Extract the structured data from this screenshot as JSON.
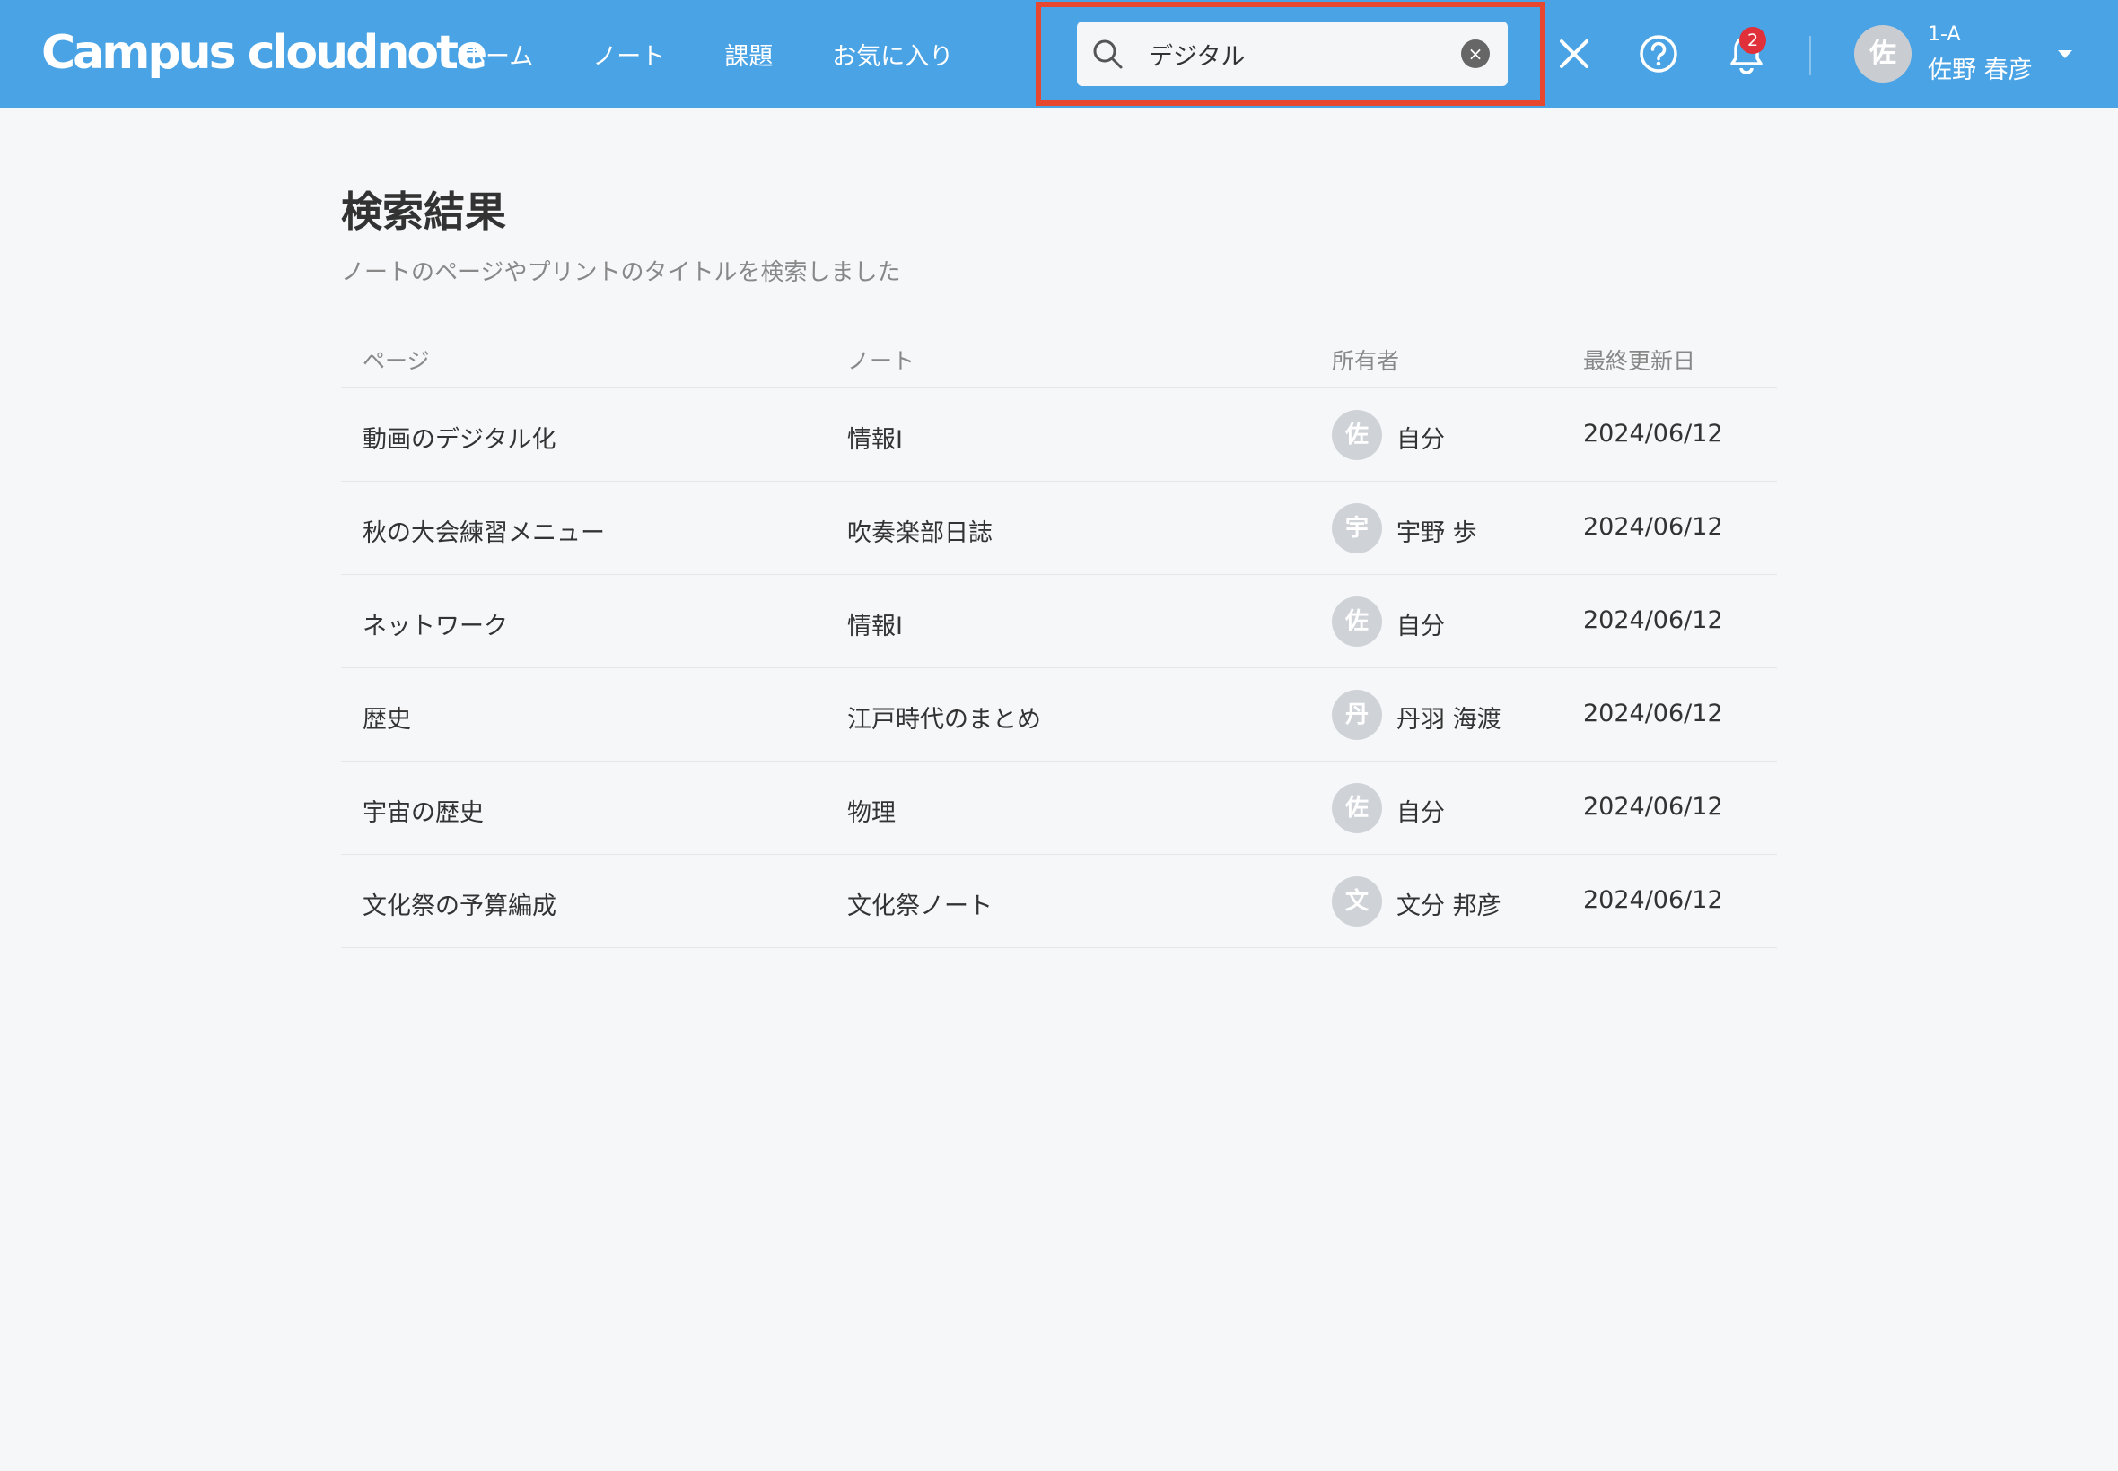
{
  "app": {
    "logo_text": "Campus cloudnote"
  },
  "nav": {
    "items": [
      "ホーム",
      "ノート",
      "課題",
      "お気に入り"
    ]
  },
  "search": {
    "value": "デジタル",
    "clear_glyph": "×"
  },
  "notifications": {
    "badge_count": "2"
  },
  "user": {
    "avatar_initial": "佐",
    "class": "1-A",
    "name": "佐野 春彦"
  },
  "icons": {
    "search": "search-icon",
    "clear": "clear-icon",
    "close": "close-icon",
    "help": "help-icon",
    "bell": "bell-icon",
    "caret": "chevron-down-icon"
  },
  "colors": {
    "header": "#4aa3e4",
    "highlight": "#e8472f",
    "badge": "#e0303a"
  },
  "main": {
    "title": "検索結果",
    "subtitle": "ノートのページやプリントのタイトルを検索しました"
  },
  "table": {
    "headers": {
      "page": "ページ",
      "note": "ノート",
      "owner": "所有者",
      "date": "最終更新日"
    },
    "rows": [
      {
        "page": "動画のデジタル化",
        "note": "情報I",
        "owner_initial": "佐",
        "owner": "自分",
        "date": "2024/06/12"
      },
      {
        "page": "秋の大会練習メニュー",
        "note": "吹奏楽部日誌",
        "owner_initial": "宇",
        "owner": "宇野 歩",
        "date": "2024/06/12"
      },
      {
        "page": "ネットワーク",
        "note": "情報I",
        "owner_initial": "佐",
        "owner": "自分",
        "date": "2024/06/12"
      },
      {
        "page": "歴史",
        "note": "江戸時代のまとめ",
        "owner_initial": "丹",
        "owner": "丹羽 海渡",
        "date": "2024/06/12"
      },
      {
        "page": "宇宙の歴史",
        "note": "物理",
        "owner_initial": "佐",
        "owner": "自分",
        "date": "2024/06/12"
      },
      {
        "page": "文化祭の予算編成",
        "note": "文化祭ノート",
        "owner_initial": "文",
        "owner": "文分 邦彦",
        "date": "2024/06/12"
      }
    ]
  }
}
